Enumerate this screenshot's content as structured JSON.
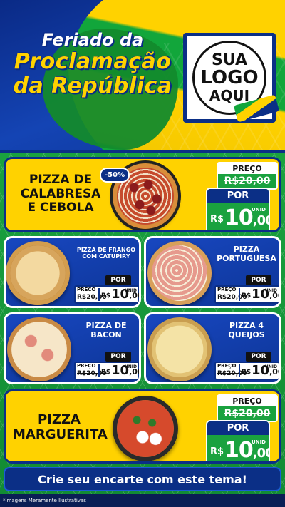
{
  "header": {
    "title_line1": "Feriado da",
    "title_line2": "Proclamação",
    "title_line3": "da República",
    "logo_line1": "SUA",
    "logo_line2": "LOGO",
    "logo_line3": "AQUI"
  },
  "products": [
    {
      "name_line1": "PIZZA DE",
      "name_line2": "CALABRESA",
      "name_line3": "E CEBOLA",
      "badge": "-50%",
      "preco_label": "PREÇO",
      "old_price": "R$20,00",
      "por_label": "POR",
      "currency": "R$",
      "price_int": "10",
      "price_cents": ",00",
      "unit": "UNID"
    },
    {
      "name_line1": "PIZZA DE FRANGO",
      "name_line2": "COM CATUPIRY",
      "preco_label": "PREÇO",
      "old_price": "R$20,00",
      "por_label": "POR",
      "currency": "R$",
      "price_int": "10",
      "price_cents": ",00",
      "unit": "UNID"
    },
    {
      "name_line1": "PIZZA",
      "name_line2": "PORTUGUESA",
      "preco_label": "PREÇO",
      "old_price": "R$20,00",
      "por_label": "POR",
      "currency": "R$",
      "price_int": "10",
      "price_cents": ",00",
      "unit": "UNID"
    },
    {
      "name_line1": "PIZZA DE",
      "name_line2": "BACON",
      "preco_label": "PREÇO",
      "old_price": "R$20,00",
      "por_label": "POR",
      "currency": "R$",
      "price_int": "10",
      "price_cents": ",00",
      "unit": "UNID"
    },
    {
      "name_line1": "PIZZA 4",
      "name_line2": "QUEIJOS",
      "preco_label": "PREÇO",
      "old_price": "R$20,00",
      "por_label": "POR",
      "currency": "R$",
      "price_int": "10",
      "price_cents": ",00",
      "unit": "UNID"
    },
    {
      "name_line1": "PIZZA",
      "name_line2": "MARGUERITA",
      "preco_label": "PREÇO",
      "old_price": "R$20,00",
      "por_label": "POR",
      "currency": "R$",
      "price_int": "10",
      "price_cents": ",00",
      "unit": "UNID"
    }
  ],
  "footer": {
    "cta": "Crie seu encarte com este tema!",
    "disclaimer": "*Imagens Meramente Ilustrativas"
  },
  "colors": {
    "brand_blue": "#0b2f86",
    "brand_yellow": "#ffd200",
    "brand_green": "#1aa23f"
  }
}
